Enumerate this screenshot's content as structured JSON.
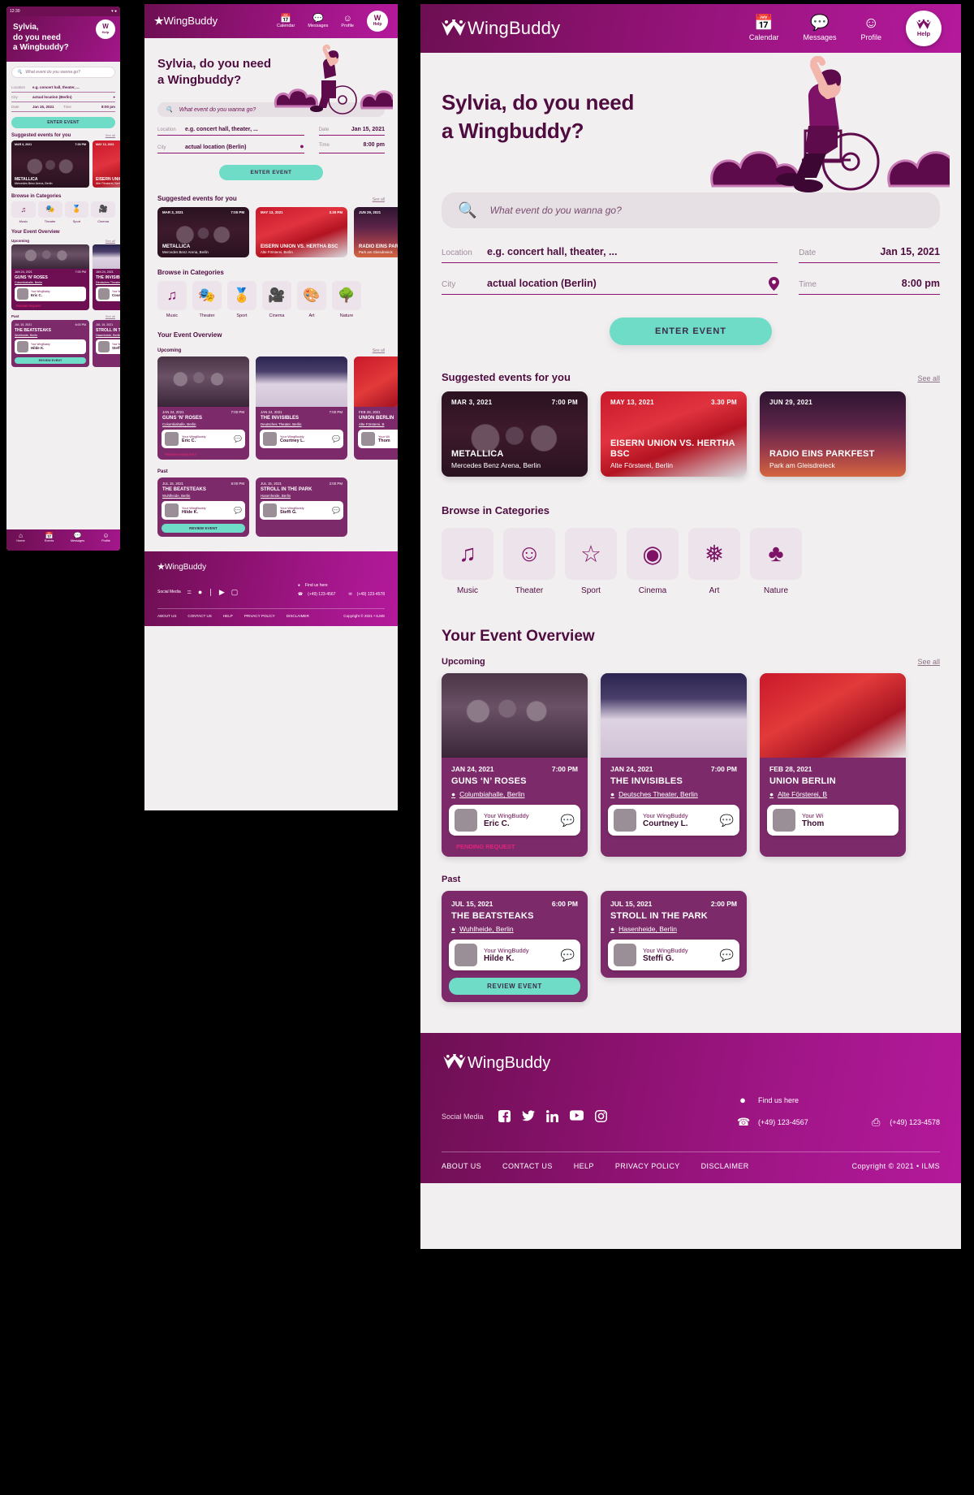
{
  "brand": {
    "name_bold": "Wing",
    "name_light": "Buddy",
    "help_label": "Help",
    "accent_teal": "#6fdcc8",
    "accent_purple": "#8e1272",
    "accent_dark": "#4e0c3f",
    "pending_color": "#e0247a"
  },
  "status_bar": {
    "time": "12:30"
  },
  "nav": {
    "items": [
      {
        "label": "Calendar",
        "icon": "calendar-icon"
      },
      {
        "label": "Messages",
        "icon": "message-icon"
      },
      {
        "label": "Profile",
        "icon": "profile-icon"
      }
    ],
    "help": "Help"
  },
  "mobile_nav": {
    "items": [
      {
        "label": "Home",
        "icon": "home-icon"
      },
      {
        "label": "Events",
        "icon": "events-icon"
      },
      {
        "label": "Messages",
        "icon": "message-icon"
      },
      {
        "label": "Profile",
        "icon": "profile-icon"
      }
    ]
  },
  "hero": {
    "line1": "Sylvia, do you need",
    "line2": "a Wingbuddy?",
    "mobile_line1": "Sylvia,",
    "mobile_line2": "do you need",
    "mobile_line3": "a Wingbuddy?"
  },
  "search": {
    "placeholder": "What event do you wanna go?",
    "icon": "search-icon"
  },
  "form": {
    "location": {
      "label": "Location",
      "value": "e.g. concert hall, theater, ..."
    },
    "date": {
      "label": "Date",
      "value": "Jan 15, 2021"
    },
    "city": {
      "label": "City",
      "value": "actual location (Berlin)",
      "icon": "location-pin-icon"
    },
    "time": {
      "label": "Time",
      "value": "8:00 pm"
    },
    "submit": "ENTER EVENT"
  },
  "suggested": {
    "title": "Suggested events for you",
    "see_all": "See all",
    "events": [
      {
        "date": "MAR 3, 2021",
        "time": "7:00 PM",
        "title": "METALLICA",
        "venue": "Mercedes Benz Arena, Berlin",
        "photo": "ph-metallica"
      },
      {
        "date": "MAY 13, 2021",
        "time": "3.30 PM",
        "title": "EISERN UNION VS. HERTHA BSC",
        "venue": "Alte Försterei, Berlin",
        "photo": "ph-union"
      },
      {
        "date": "JUN 29, 2021",
        "time": "",
        "title": "RADIO EINS PARKFEST",
        "venue": "Park am Gleisdreieck",
        "photo": "ph-radio"
      }
    ]
  },
  "categories": {
    "title": "Browse in Categories",
    "items": [
      {
        "label": "Music",
        "icon": "music-note-icon",
        "glyph": "♫"
      },
      {
        "label": "Theater",
        "icon": "theater-masks-icon",
        "glyph": "🎭"
      },
      {
        "label": "Sport",
        "icon": "medal-icon",
        "glyph": "🏅"
      },
      {
        "label": "Cinema",
        "icon": "film-camera-icon",
        "glyph": "🎥"
      },
      {
        "label": "Art",
        "icon": "palette-icon",
        "glyph": "🎨"
      },
      {
        "label": "Nature",
        "icon": "tree-icon",
        "glyph": "🌳"
      }
    ]
  },
  "overview": {
    "title": "Your Event Overview",
    "upcoming_label": "Upcoming",
    "past_label": "Past",
    "see_all": "See all",
    "upcoming": [
      {
        "date": "JAN 24, 2021",
        "time": "7:00 PM",
        "title": "GUNS ‘N’ ROSES",
        "venue": "Columbiahalle, Berlin",
        "buddy_label": "Your WingBuddy",
        "buddy_name": "Eric C.",
        "status": "PENDING REQUEST",
        "photo": "ph-gnr",
        "avatar": "ph-av1"
      },
      {
        "date": "JAN 24, 2021",
        "time": "7:00 PM",
        "title": "THE INVISIBLES",
        "venue": "Deutsches Theater, Berlin",
        "buddy_label": "Your WingBuddy",
        "buddy_name": "Courtney L.",
        "status": "",
        "photo": "ph-theater",
        "avatar": "ph-av2"
      },
      {
        "date": "FEB 28, 2021",
        "time": "",
        "title": "UNION BERLIN",
        "venue": "Alte Försterei, B",
        "buddy_label": "Your Wi",
        "buddy_name": "Thom",
        "status": "",
        "photo": "ph-berlin",
        "avatar": "ph-av3"
      }
    ],
    "past": [
      {
        "date": "JUL 15, 2021",
        "time": "6:00 PM",
        "title": "THE BEATSTEAKS",
        "venue": "Wuhlheide, Berlin",
        "buddy_label": "Your WingBuddy",
        "buddy_name": "Hilde K.",
        "review": "REVIEW EVENT",
        "avatar": "ph-av4"
      },
      {
        "date": "JUL 15, 2021",
        "time": "2:00 PM",
        "title": "STROLL IN THE PARK",
        "venue": "Hasenheide, Berlin",
        "buddy_label": "Your WingBuddy",
        "buddy_name": "Steffi G.",
        "review": "",
        "avatar": "ph-av5"
      }
    ]
  },
  "footer": {
    "social_label": "Social Media",
    "social": [
      {
        "name": "facebook-icon",
        "glyph": "f"
      },
      {
        "name": "twitter-icon",
        "glyph": "ᵛ"
      },
      {
        "name": "linkedin-icon",
        "glyph": "in"
      },
      {
        "name": "youtube-icon",
        "glyph": "▶"
      },
      {
        "name": "instagram-icon",
        "glyph": "▢"
      }
    ],
    "find_us": "Find us here",
    "phone": "(+49) 123-4567",
    "fax": "(+49) 123-4578",
    "links": [
      "ABOUT US",
      "CONTACT US",
      "HELP",
      "PRIVACY POLICY",
      "DISCLAIMER"
    ],
    "copyright": "Copyright © 2021 • ILMS"
  }
}
